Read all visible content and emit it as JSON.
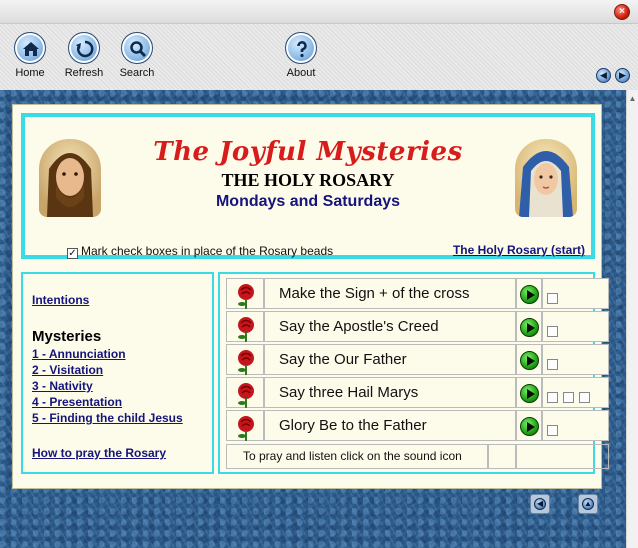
{
  "window": {
    "close_symbol": "×"
  },
  "toolbar": {
    "buttons": [
      {
        "label": "Home",
        "icon": "home-icon"
      },
      {
        "label": "Refresh",
        "icon": "refresh-icon"
      },
      {
        "label": "Search",
        "icon": "search-icon"
      },
      {
        "label": "About",
        "icon": "help-icon"
      }
    ],
    "back_symbol": "◀",
    "forward_symbol": "▶"
  },
  "header": {
    "title": "The Joyful Mysteries",
    "subtitle": "THE HOLY ROSARY",
    "days": "Mondays and Saturdays",
    "checkbox_checked": true,
    "check_mark": "✓",
    "checkbox_label": "Mark check boxes in place of the Rosary beads",
    "start_link": "The Holy Rosary (start)"
  },
  "sidebar": {
    "intentions": "Intentions",
    "mysteries_heading": "Mysteries",
    "mysteries": [
      "1 - Annunciation",
      "2 - Visitation",
      "3 - Nativity",
      "4 - Presentation",
      "5 - Finding the child Jesus"
    ],
    "how_to": "How to pray the Rosary"
  },
  "prayers": {
    "rows": [
      {
        "text": "Make the Sign + of the cross",
        "checkboxes": 1
      },
      {
        "text": "Say the Apostle's Creed",
        "checkboxes": 1
      },
      {
        "text": "Say the Our Father",
        "checkboxes": 1
      },
      {
        "text": "Say three Hail Marys",
        "checkboxes": 3
      },
      {
        "text": "Glory Be to the Father",
        "checkboxes": 1
      }
    ],
    "footer_note": "To pray and listen click on the sound icon"
  },
  "page_nav": {
    "back_symbol": "◀",
    "top_symbol": "▲"
  },
  "colors": {
    "accent_border": "#39dbe6",
    "title_red": "#d81c1c",
    "link_navy": "#14147a",
    "page_bg": "#fdfbe9"
  }
}
